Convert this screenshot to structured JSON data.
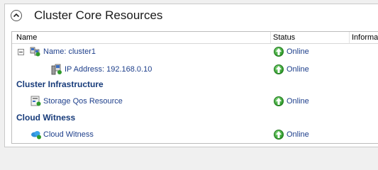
{
  "panel": {
    "title": "Cluster Core Resources"
  },
  "columns": {
    "name": "Name",
    "status": "Status",
    "information": "Informati"
  },
  "rows": {
    "cluster_name": {
      "label": "Name: cluster1",
      "status": "Online",
      "icon": "cluster-name-icon"
    },
    "ip_address": {
      "label": "IP Address: 192.168.0.10",
      "status": "Online",
      "icon": "ip-address-icon"
    }
  },
  "groups": {
    "infrastructure": {
      "title": "Cluster Infrastructure",
      "item": {
        "label": "Storage Qos Resource",
        "status": "Online",
        "icon": "storage-qos-icon"
      }
    },
    "witness": {
      "title": "Cloud Witness",
      "item": {
        "label": "Cloud Witness",
        "status": "Online",
        "icon": "cloud-icon"
      }
    }
  },
  "colors": {
    "online": "#2f9a2b",
    "link": "#1e3f8b",
    "group_title": "#173b7a"
  }
}
